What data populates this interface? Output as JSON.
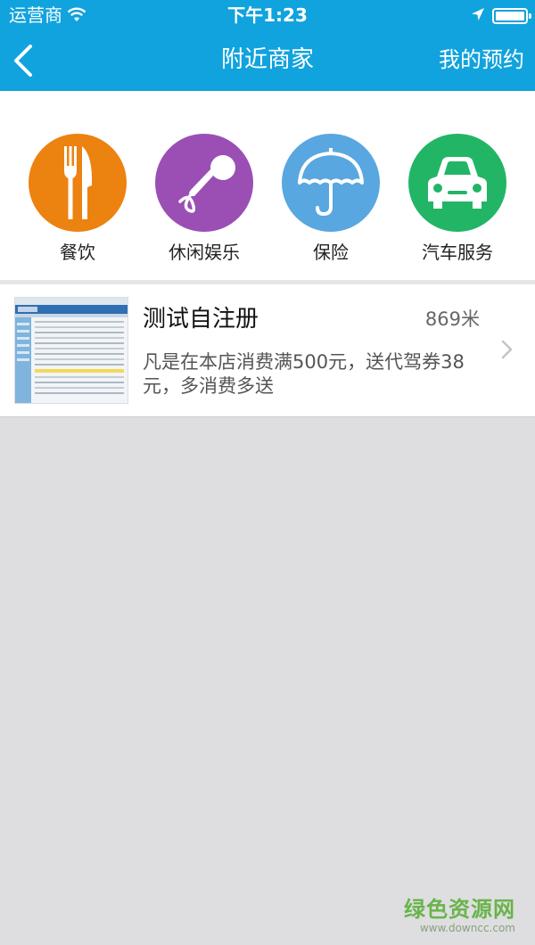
{
  "status_bar": {
    "carrier": "运营商",
    "time": "下午1:23",
    "icons": [
      "wifi-icon",
      "location-arrow-icon",
      "battery-icon"
    ]
  },
  "nav": {
    "back_icon": "chevron-left-icon",
    "title": "附近商家",
    "right_button": "我的预约"
  },
  "categories": [
    {
      "label": "餐饮",
      "icon": "fork-knife-icon",
      "color": "#ec8210"
    },
    {
      "label": "休闲娱乐",
      "icon": "microphone-icon",
      "color": "#9b4fb5"
    },
    {
      "label": "保险",
      "icon": "umbrella-icon",
      "color": "#59a7e0"
    },
    {
      "label": "汽车服务",
      "icon": "car-icon",
      "color": "#22b566"
    }
  ],
  "merchants": [
    {
      "name": "测试自注册",
      "distance": "869米",
      "description": "凡是在本店消费满500元，送代驾券38元，多消费多送"
    }
  ],
  "watermark": {
    "title": "绿色资源网",
    "url": "www.downcc.com"
  },
  "colors": {
    "header": "#11a3dd",
    "background": "#dedee0"
  }
}
